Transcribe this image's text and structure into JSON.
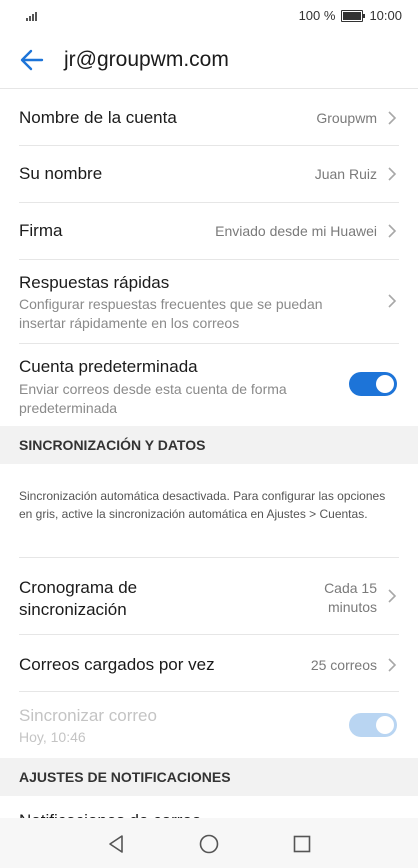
{
  "status_bar": {
    "battery_percent": "100 %",
    "time": "10:00"
  },
  "header": {
    "title": "jr@groupwm.com"
  },
  "settings": {
    "account_name": {
      "label": "Nombre de la cuenta",
      "value": "Groupwm"
    },
    "your_name": {
      "label": "Su nombre",
      "value": "Juan Ruiz"
    },
    "signature": {
      "label": "Firma",
      "value": "Enviado desde mi Huawei"
    },
    "quick_replies": {
      "label": "Respuestas rápidas",
      "description": "Configurar respuestas frecuentes que se puedan insertar rápidamente en los correos"
    },
    "default_account": {
      "label": "Cuenta predeterminada",
      "description": "Enviar correos desde esta cuenta de forma predeterminada",
      "enabled": true
    }
  },
  "sync_section": {
    "header": "SINCRONIZACIÓN Y DATOS",
    "info": "Sincronización automática desactivada. Para configurar las opciones en gris, active la sincronización automática en Ajustes > Cuentas.",
    "schedule": {
      "label": "Cronograma de sincronización",
      "value": "Cada 15 minutos"
    },
    "emails_per_load": {
      "label": "Correos cargados por vez",
      "value": "25 correos"
    },
    "sync_mail": {
      "label": "Sincronizar correo",
      "sublabel": "Hoy, 10:46",
      "enabled": true,
      "disabled": true
    }
  },
  "notifications_section": {
    "header": "AJUSTES DE NOTIFICACIONES",
    "mail_notifications": {
      "label": "Notificaciones de correo"
    }
  },
  "nav_bar": {
    "icons": [
      "back-triangle-icon",
      "home-circle-icon",
      "recents-square-icon"
    ]
  },
  "colors": {
    "accent": "#1d74d8",
    "section_bg": "#f2f2f2"
  }
}
